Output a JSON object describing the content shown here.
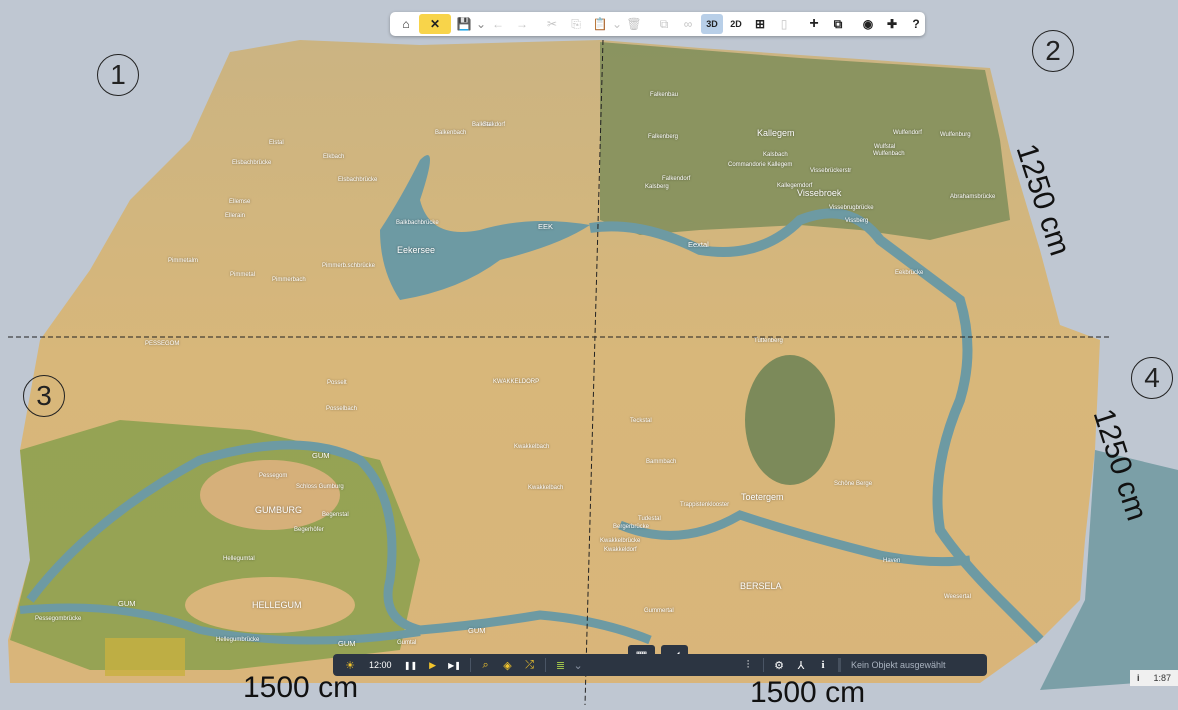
{
  "toolbar": {
    "home": "⌂",
    "tools": "✕",
    "save": "💾",
    "save_menu": "⌄",
    "undo": "←",
    "redo": "→",
    "cut": "✂",
    "copy": "⎘",
    "paste": "📋",
    "paste_menu": "⌄",
    "delete": "🗑",
    "group": "⧉",
    "link": "∞",
    "view_3d": "3D",
    "view_2d": "2D",
    "grid": "⊞",
    "train": "▯",
    "add": "+",
    "windows": "⧉",
    "camera": "◉",
    "plugins": "✚",
    "help": "?"
  },
  "bottombar": {
    "sun": "☀",
    "time": "12:00",
    "pause": "❚❚",
    "play": "▶",
    "step": "▶❚",
    "search": "⌕",
    "layers": "◈",
    "shuffle": "⤮",
    "list": "≣",
    "list_menu": "⌄",
    "mixer": "⫶",
    "settings": "⚙",
    "axes": "⅄",
    "info": "i",
    "status": "Kein Objekt ausgewählt"
  },
  "mode_buttons": {
    "tiles": "▦",
    "terrain": "◢"
  },
  "corner": {
    "info": "i",
    "scale": "1:87"
  },
  "quadrants": [
    "1",
    "2",
    "3",
    "4"
  ],
  "dimensions": {
    "right_top": "1250 cm",
    "right_bottom": "1250 cm",
    "bottom_left": "1500 cm",
    "bottom_right": "1500 cm"
  },
  "labels": {
    "big": [
      "Eekersee",
      "EEK",
      "Kallegem",
      "Vissebroek",
      "Eextal",
      "PESSEGOM",
      "GUM",
      "GUMBURG",
      "HELLEGUM",
      "GUM",
      "GUM",
      "GUM",
      "Toetergem",
      "BERSELA",
      "KWAKKELDORP"
    ],
    "small": [
      "Elstal",
      "Elsbachbrücke",
      "Elkbach",
      "Elsbachbrücke",
      "Ellemse",
      "Ellerain",
      "Balkdorf",
      "Balkenbach",
      "Balkstal",
      "Balkbachbrücke",
      "Pimmetalm",
      "Pimmetal",
      "Pimmerbach",
      "Pimmerb.schbrücke",
      "Falkenbau",
      "Falkenberg",
      "Commandorie Kallegem",
      "Kalsbach",
      "Falkendorf",
      "Kalsberg",
      "Kallegemdorf",
      "Vissebrückerstr",
      "Vissebrugbrücke",
      "Vissberg",
      "Wulfendorf",
      "Wulfenburg",
      "Wulfstal",
      "Wulfenbach",
      "Abrahamsbrücke",
      "Eekbrücke",
      "Posselt",
      "Posselbach",
      "Kwakkelbach",
      "Kwakkelbach",
      "Pessegom",
      "Schloss Gumburg",
      "Begenstal",
      "Begerhöfer",
      "Hellegumtal",
      "Hellegumbrücke",
      "Gumtal",
      "Pessegombrücke",
      "Teckstal",
      "Bammbach",
      "Trappistenklooster",
      "Schöne Berge",
      "Tudestal",
      "Bergerbrücke",
      "Kwakkelbrücke",
      "Kwakkeldorf",
      "Haven",
      "Weesertal",
      "Gummertal",
      "Tuttenberg"
    ]
  },
  "colors": {
    "sand": "#d9b97e",
    "grass": "#8fa24c",
    "water": "#6d9aa3",
    "sky": "#bfc7d2",
    "toolbar_dark": "#2c3542",
    "accent": "#f8d44a"
  }
}
